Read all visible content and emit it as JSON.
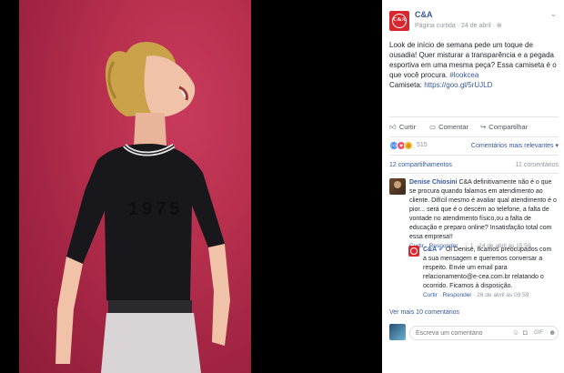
{
  "page": {
    "name": "C&A",
    "meta": "Página curtida · 24 de abril · ",
    "logo_text": "C&A"
  },
  "post": {
    "text": "Look de início de semana pede um toque de ousadia! Quer misturar a transparência e a pegada esportiva em uma mesma peça? Essa camiseta é o que você procura. ",
    "hashtag": "#lookcea",
    "shirt_label": "Camiseta: ",
    "link": "https://goo.gl/5rUJLD"
  },
  "actions": {
    "like": "Curtir",
    "comment": "Comentar",
    "share": "Compartilhar"
  },
  "reactions": {
    "count": "515",
    "sort": "Comentários mais relevantes ▾"
  },
  "stats": {
    "shares": "12 compartilhamentos",
    "comments": "11 comentários"
  },
  "comment1": {
    "author": "Denise Chiosini",
    "text": " C&A definitivamente não é o que se procura quando falamos em atendimento ao cliente. Difícil mesmo é avaliar qual atendimento é o pior... será que é o descém ao telefone, a falta de vontade no atendimento físico,ou a falta de educação e preparo online? Insatisfação total com essa empresa!!",
    "like": "Curtir",
    "reply": "Responder",
    "meta": " · ♡ 1 · 24 de abril às 15:50"
  },
  "reply1": {
    "author": "C&A",
    "text": " Oi Denise, ficamos preocupados com a sua mensagem e queremos conversar a respeito. Envie um email para relacionamento@e-cea.com.br relatando o ocorrido. Ficamos à disposição.",
    "like": "Curtir",
    "reply": "Responder",
    "meta": " · 26 de abril às 09:59"
  },
  "more_comments": "Ver mais 10 comentários",
  "composer": {
    "placeholder": "Escreva um comentário"
  },
  "colors": {
    "fb_link": "#365899",
    "brand_red": "#d7282f",
    "photo_bg": "#b8304e"
  }
}
